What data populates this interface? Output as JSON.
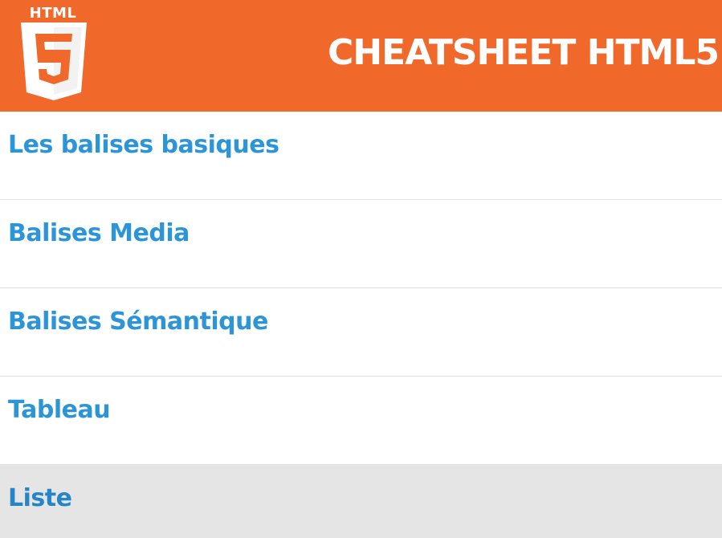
{
  "header": {
    "logo_text": "HTML",
    "logo_icon": "html5-logo-icon",
    "title": "CHEATSHEET HTML5"
  },
  "menu": {
    "items": [
      {
        "label": "Les balises basiques"
      },
      {
        "label": "Balises Media"
      },
      {
        "label": "Balises Sémantique"
      },
      {
        "label": "Tableau"
      },
      {
        "label": "Liste"
      }
    ],
    "active_item": "Liste"
  },
  "colors": {
    "header_bg": "#f0692a",
    "link": "#2b95d8",
    "active_bg": "#e5e5e5",
    "divider": "#e2e2e2"
  }
}
